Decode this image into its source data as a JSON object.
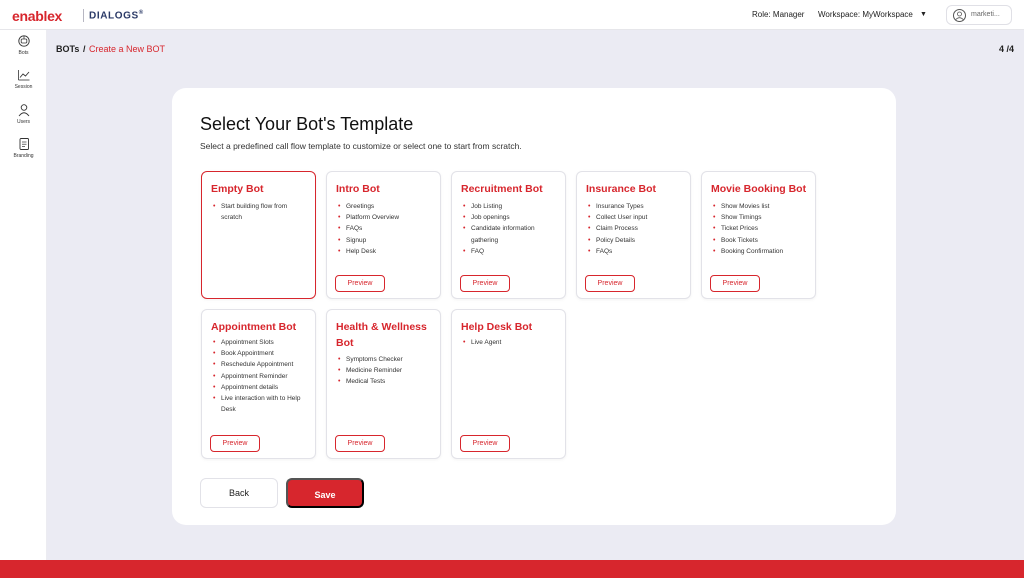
{
  "header": {
    "brand": "enablex",
    "brand_sub": "DIALOGS",
    "brand_mark": "®",
    "role_label": "Role: Manager",
    "workspace_label": "Workspace: MyWorkspace",
    "user_name": "marketi..."
  },
  "sidebar": {
    "items": [
      {
        "label": "Bots",
        "icon": "bot-icon"
      },
      {
        "label": "Session",
        "icon": "chart-line-icon"
      },
      {
        "label": "Users",
        "icon": "user-icon"
      },
      {
        "label": "Branding",
        "icon": "document-icon"
      }
    ]
  },
  "breadcrumb": {
    "root": "BOTs",
    "separator": "/",
    "current": "Create a New BOT",
    "step": "4 /4"
  },
  "page": {
    "title": "Select Your Bot's Template",
    "subtitle": "Select a predefined call flow template to customize or select one to start from scratch."
  },
  "templates": [
    {
      "title": "Empty Bot",
      "items": [
        "Start building flow from scratch"
      ],
      "preview": "",
      "selected": true
    },
    {
      "title": "Intro Bot",
      "items": [
        "Greetings",
        "Platform Overview",
        "FAQs",
        "Signup",
        "Help Desk"
      ],
      "preview": "Preview",
      "selected": false
    },
    {
      "title": "Recruitment Bot",
      "items": [
        "Job Listing",
        "Job openings",
        "Candidate information gathering",
        "FAQ"
      ],
      "preview": "Preview",
      "selected": false
    },
    {
      "title": "Insurance Bot",
      "items": [
        "Insurance Types",
        "Collect User input",
        "Claim Process",
        "Policy Details",
        "FAQs"
      ],
      "preview": "Preview",
      "selected": false
    },
    {
      "title": "Movie Booking Bot",
      "items": [
        "Show Movies list",
        "Show Timings",
        "Ticket Prices",
        "Book Tickets",
        "Booking Confirmation"
      ],
      "preview": "Preview",
      "selected": false
    },
    {
      "title": "Appointment Bot",
      "items": [
        "Appointment Slots",
        "Book Appointment",
        "Reschedule Appointment",
        "Appointment Reminder",
        "Appointment details",
        "Live interaction with to Help Desk"
      ],
      "preview": "Preview",
      "selected": false
    },
    {
      "title": "Health & Wellness Bot",
      "items": [
        "Symptoms Checker",
        "Medicine Reminder",
        "Medical Tests"
      ],
      "preview": "Preview",
      "selected": false
    },
    {
      "title": "Help Desk Bot",
      "items": [
        "Live Agent"
      ],
      "preview": "Preview",
      "selected": false
    }
  ],
  "actions": {
    "back": "Back",
    "save": "Save"
  },
  "colors": {
    "accent": "#d7262d",
    "background": "#ebebf3"
  }
}
